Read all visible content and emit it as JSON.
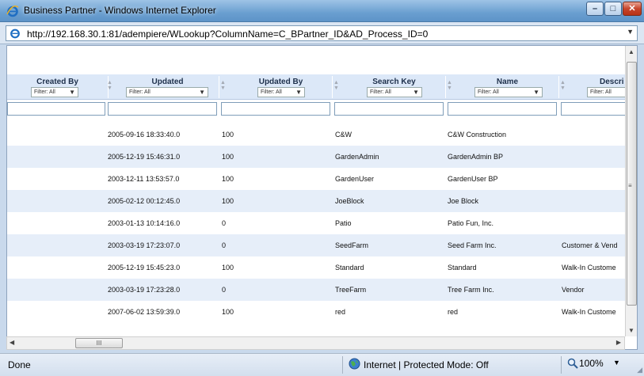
{
  "window": {
    "title": "Business Partner - Windows Internet Explorer"
  },
  "address": {
    "url": "http://192.168.30.1:81/adempiere/WLookup?ColumnName=C_BPartner_ID&AD_Process_ID=0"
  },
  "grid": {
    "columns": [
      {
        "label": "Created By",
        "filter": "Filter: All"
      },
      {
        "label": "Updated",
        "filter": "Filter: All"
      },
      {
        "label": "Updated By",
        "filter": "Filter: All"
      },
      {
        "label": "Search Key",
        "filter": "Filter: All"
      },
      {
        "label": "Name",
        "filter": "Filter: All"
      },
      {
        "label": "Descri",
        "filter": "Filter: All"
      }
    ],
    "rows": [
      {
        "updated": "2005-09-16 18:33:40.0",
        "updated_by": "100",
        "search_key": "C&W",
        "name": "C&W Construction",
        "description": ""
      },
      {
        "updated": "2005-12-19 15:46:31.0",
        "updated_by": "100",
        "search_key": "GardenAdmin",
        "name": "GardenAdmin BP",
        "description": ""
      },
      {
        "updated": "2003-12-11 13:53:57.0",
        "updated_by": "100",
        "search_key": "GardenUser",
        "name": "GardenUser BP",
        "description": ""
      },
      {
        "updated": "2005-02-12 00:12:45.0",
        "updated_by": "100",
        "search_key": "JoeBlock",
        "name": "Joe Block",
        "description": ""
      },
      {
        "updated": "2003-01-13 10:14:16.0",
        "updated_by": "0",
        "search_key": "Patio",
        "name": "Patio Fun, Inc.",
        "description": ""
      },
      {
        "updated": "2003-03-19 17:23:07.0",
        "updated_by": "0",
        "search_key": "SeedFarm",
        "name": "Seed Farm Inc.",
        "description": "Customer & Vend"
      },
      {
        "updated": "2005-12-19 15:45:23.0",
        "updated_by": "100",
        "search_key": "Standard",
        "name": "Standard",
        "description": "Walk-In Custome"
      },
      {
        "updated": "2003-03-19 17:23:28.0",
        "updated_by": "0",
        "search_key": "TreeFarm",
        "name": "Tree Farm Inc.",
        "description": "Vendor"
      },
      {
        "updated": "2007-06-02 13:59:39.0",
        "updated_by": "100",
        "search_key": "red",
        "name": "red",
        "description": "Walk-In Custome"
      }
    ]
  },
  "hscroll": {
    "grip": "III"
  },
  "status": {
    "text": "Done",
    "zone": "Internet | Protected Mode: Off",
    "zoom": "100%"
  },
  "colors": {
    "title_bar": "#6a9fd0",
    "header_bg": "#dce8f8",
    "alt_row": "#e6eef9"
  }
}
